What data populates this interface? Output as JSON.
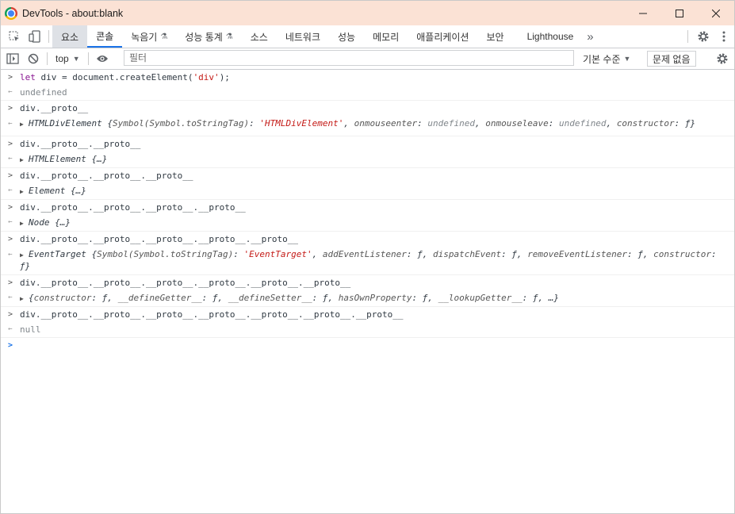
{
  "window": {
    "title": "DevTools - about:blank",
    "controls": {
      "minimize": "—",
      "maximize": "☐",
      "close": "✕"
    }
  },
  "tabs": [
    {
      "label": "요소"
    },
    {
      "label": "콘솔"
    },
    {
      "label": "녹음기",
      "experimental": true
    },
    {
      "label": "성능 통계",
      "experimental": true
    },
    {
      "label": "소스"
    },
    {
      "label": "네트워크"
    },
    {
      "label": "성능"
    },
    {
      "label": "메모리"
    },
    {
      "label": "애플리케이션"
    },
    {
      "label": "보안"
    },
    {
      "label": "Lighthouse"
    }
  ],
  "more_tabs_glyph": "»",
  "toolbar": {
    "context": "top",
    "filter_placeholder": "필터",
    "levels": "기본 수준",
    "issues": "문제 없음"
  },
  "console": [
    {
      "input": "let div = document.createElement('div');",
      "output": "undefined",
      "output_type": "undefined"
    },
    {
      "input": "div.__proto__",
      "output": "HTMLDivElement {Symbol(Symbol.toStringTag): 'HTMLDivElement', onmouseenter: undefined, onmouseleave: undefined, constructor: ƒ}",
      "output_type": "object"
    },
    {
      "input": "div.__proto__.__proto__",
      "output": "HTMLElement {…}",
      "output_type": "object"
    },
    {
      "input": "div.__proto__.__proto__.__proto__",
      "output": "Element {…}",
      "output_type": "object"
    },
    {
      "input": "div.__proto__.__proto__.__proto__.__proto__",
      "output": "Node {…}",
      "output_type": "object"
    },
    {
      "input": "div.__proto__.__proto__.__proto__.__proto__.__proto__",
      "output": "EventTarget {Symbol(Symbol.toStringTag): 'EventTarget', addEventListener: ƒ, dispatchEvent: ƒ, removeEventListener: ƒ, constructor: ƒ}",
      "output_type": "object"
    },
    {
      "input": "div.__proto__.__proto__.__proto__.__proto__.__proto__.__proto__",
      "output": "{constructor: ƒ, __defineGetter__: ƒ, __defineSetter__: ƒ, hasOwnProperty: ƒ, __lookupGetter__: ƒ, …}",
      "output_type": "object"
    },
    {
      "input": "div.__proto__.__proto__.__proto__.__proto__.__proto__.__proto__.__proto__",
      "output": "null",
      "output_type": "undefined"
    }
  ],
  "colors": {
    "titlebar": "#fbe2d5",
    "active_tab_underline": "#1a73e8",
    "string": "#c41a16",
    "keyword": "#881391"
  }
}
